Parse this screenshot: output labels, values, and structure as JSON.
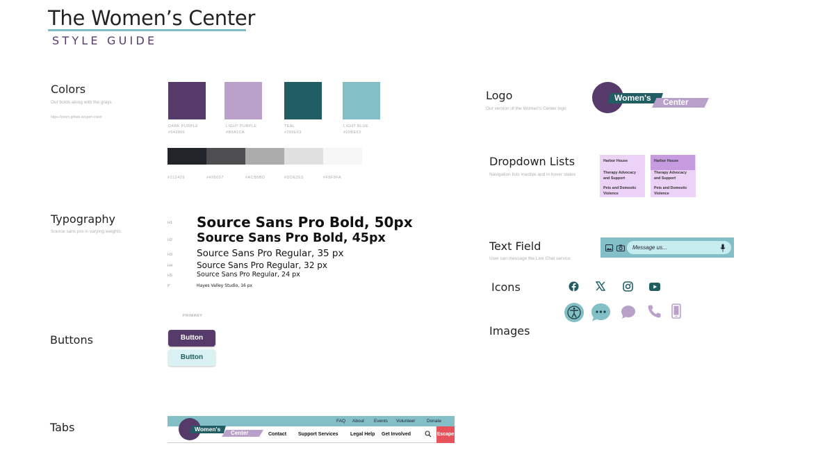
{
  "header": {
    "title": "The Women’s Center",
    "subtitle": "STYLE GUIDE"
  },
  "colors": {
    "heading": "Colors",
    "description": "Our bolds along with the grays",
    "link": "https://years.githeb.io/open-color/",
    "swatches": [
      {
        "name": "DARK PURPLE",
        "hex": "#543866",
        "color": "#553a6a"
      },
      {
        "name": "LIGHT PURPLE",
        "hex": "#B9A1CA",
        "color": "#b9a1ca"
      },
      {
        "name": "TEAL",
        "hex": "#205E63",
        "color": "#205e63"
      },
      {
        "name": "LIGHT BLUE",
        "hex": "#20BE63",
        "color": "#82bfc6"
      }
    ],
    "grays": [
      {
        "hex": "#212429",
        "color": "#212429"
      },
      {
        "hex": "#495057",
        "color": "#4e4e50"
      },
      {
        "hex": "#ACB5BD",
        "color": "#acacac"
      },
      {
        "hex": "#DDE2E5",
        "color": "#e0e0e0"
      },
      {
        "hex": "#F8F9FA",
        "color": "#f6f6f6"
      }
    ]
  },
  "typography": {
    "heading": "Typography",
    "description": "Source sans pro in varying weights",
    "levels": [
      {
        "tag": "H1",
        "text": "Source Sans Pro Bold, 50px"
      },
      {
        "tag": "H2",
        "text": "Source Sans Pro Bold, 45px"
      },
      {
        "tag": "H3",
        "text": "Source Sans Pro Regular, 35 px"
      },
      {
        "tag": "H4",
        "text": "Source Sans Pro Regular, 32 px"
      },
      {
        "tag": "H5",
        "text": "Source Sans Pro Regular, 24 px"
      },
      {
        "tag": "P",
        "text": "Hayes Valley Studio, 16 px"
      }
    ]
  },
  "buttons": {
    "heading": "Buttons",
    "primary_label": "PRIMARY",
    "button1": "Button",
    "button2": "Button"
  },
  "tabs": {
    "heading": "Tabs",
    "top_links": [
      "FAQ",
      "About",
      "Events",
      "Volunteer",
      "Donate"
    ],
    "main_links": [
      "Contact",
      "Support Services",
      "Legal Help",
      "Get Involved"
    ],
    "escape": "Escape",
    "logo_word1": "Women's",
    "logo_word2": "Center"
  },
  "logo": {
    "heading": "Logo",
    "description": "Our version of the Women's Center logo",
    "word1": "Women's",
    "word2": "Center"
  },
  "dropdown": {
    "heading": "Dropdown Lists",
    "description": "Navigation lists inactive and in hover states",
    "items": [
      "Harbor House",
      "Therapy Advocacy and Support",
      "Pets and Domestic Violence"
    ]
  },
  "text_field": {
    "heading": "Text Field",
    "description": "User can message the Live Chat service.",
    "placeholder": "Message us..."
  },
  "icons": {
    "heading": "Icons",
    "social": [
      "facebook-icon",
      "x-icon",
      "instagram-icon",
      "youtube-icon"
    ],
    "contact": [
      "accessibility-icon",
      "chat-dots-icon",
      "chat-bubble-icon",
      "phone-icon",
      "mobile-icon"
    ]
  },
  "images": {
    "heading": "Images"
  },
  "palette": {
    "dark_purple": "#553a6a",
    "light_purple": "#b9a1ca",
    "teal": "#205e63",
    "light_blue": "#82bfc6",
    "escape_red": "#e8525a"
  }
}
